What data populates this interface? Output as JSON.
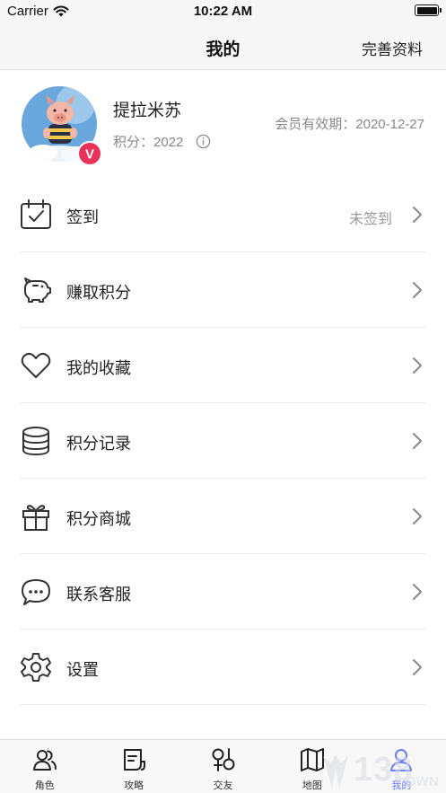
{
  "status_bar": {
    "carrier": "Carrier",
    "time": "10:22 AM"
  },
  "nav": {
    "title": "我的",
    "action": "完善资料"
  },
  "profile": {
    "name": "提拉米苏",
    "points_text": "积分：2022",
    "expiry_text": "会员有效期：2020-12-27",
    "badge": "V",
    "badge_color": "#e8325a"
  },
  "menu": [
    {
      "label": "签到",
      "value": "未签到",
      "icon": "calendar-check-icon"
    },
    {
      "label": "赚取积分",
      "value": "",
      "icon": "piggy-bank-icon"
    },
    {
      "label": "我的收藏",
      "value": "",
      "icon": "heart-icon"
    },
    {
      "label": "积分记录",
      "value": "",
      "icon": "database-icon"
    },
    {
      "label": "积分商城",
      "value": "",
      "icon": "gift-icon"
    },
    {
      "label": "联系客服",
      "value": "",
      "icon": "chat-bubble-icon"
    },
    {
      "label": "设置",
      "value": "",
      "icon": "gear-icon"
    }
  ],
  "tabs": [
    {
      "label": "角色",
      "icon": "people-icon",
      "active": false
    },
    {
      "label": "攻略",
      "icon": "guide-icon",
      "active": false
    },
    {
      "label": "交友",
      "icon": "gender-icon",
      "active": false
    },
    {
      "label": "地图",
      "icon": "map-icon",
      "active": false
    },
    {
      "label": "我的",
      "icon": "person-icon",
      "active": true
    }
  ],
  "watermark": {
    "text": "138",
    "suffix": "OWN"
  },
  "colors": {
    "accent": "#6b7ef2",
    "text": "#222222",
    "muted": "#888888"
  }
}
